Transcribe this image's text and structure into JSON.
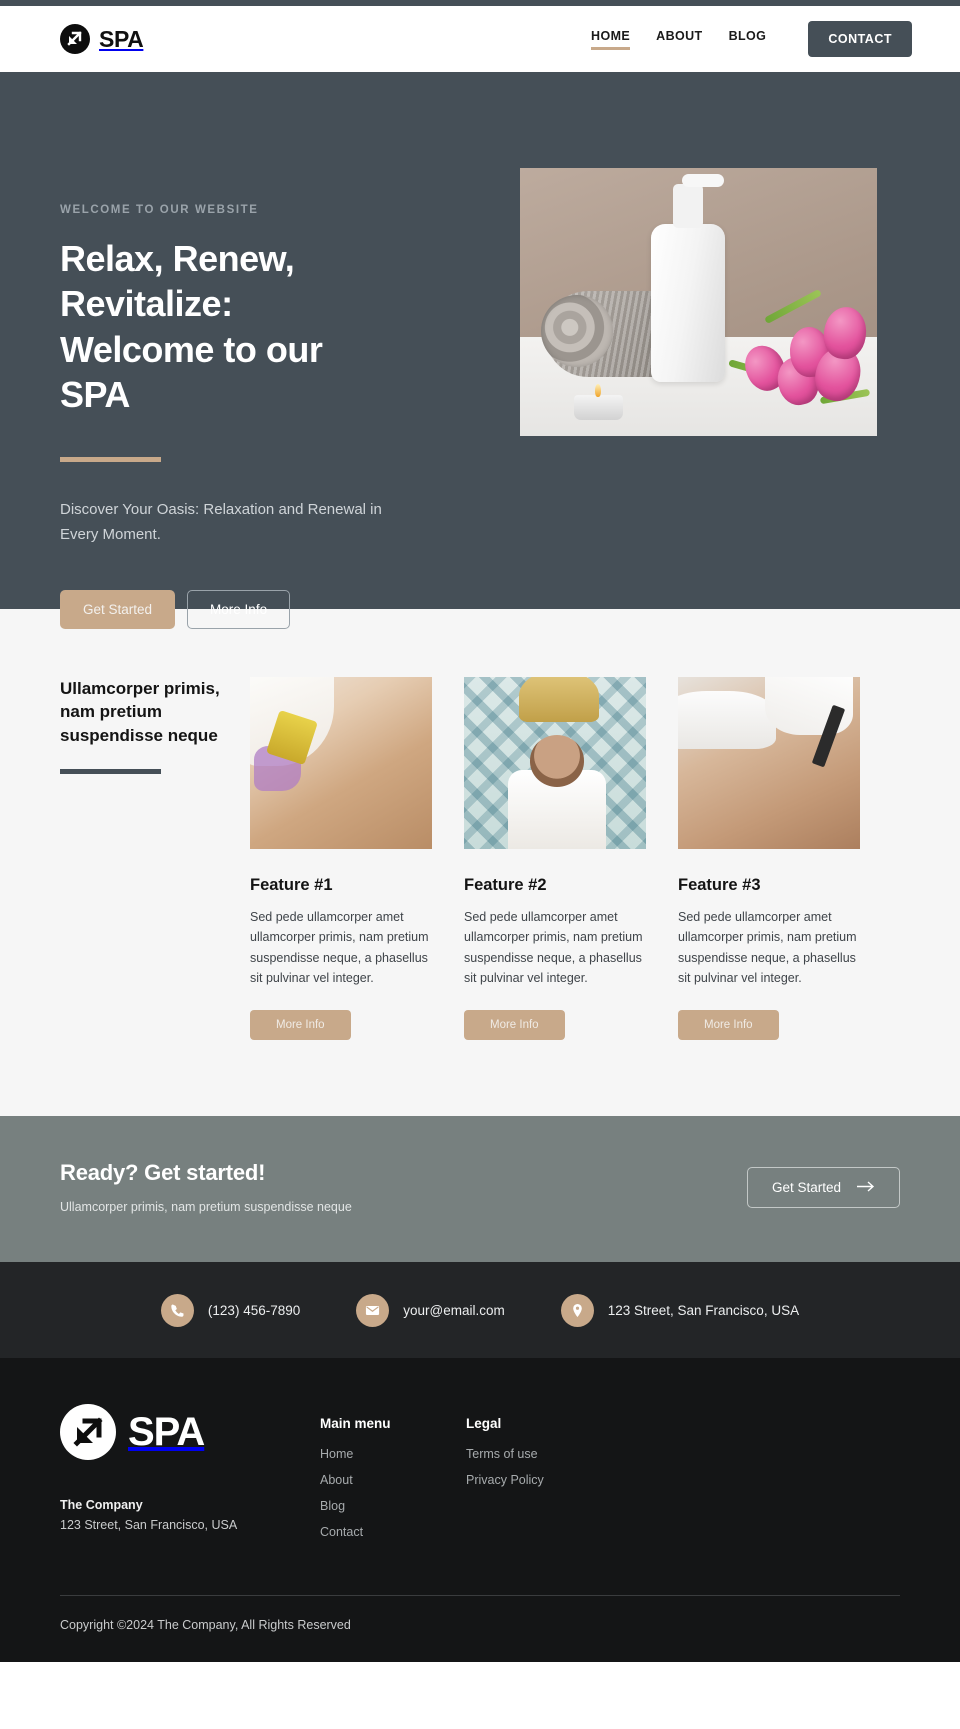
{
  "theme": {
    "accent": "#c8a98a",
    "hero_bg": "#454f57",
    "features_bg": "#f6f6f6",
    "cta_bg": "#77807f",
    "contactbar_bg": "#232527",
    "footer_bg": "#141516"
  },
  "header": {
    "brand": "SPA",
    "logo_icon": "spa-arrow-logo-icon",
    "nav": [
      {
        "label": "HOME",
        "active": true
      },
      {
        "label": "ABOUT",
        "active": false
      },
      {
        "label": "BLOG",
        "active": false
      }
    ],
    "contact_button": "CONTACT"
  },
  "hero": {
    "eyebrow": "WELCOME TO OUR WEBSITE",
    "title": "Relax, Renew, Revitalize: Welcome to our SPA",
    "subtitle": "Discover Your Oasis: Relaxation and Renewal in Every Moment.",
    "primary_button": "Get Started",
    "secondary_button": "More Info",
    "image_alt": "Rolled grey towel, white pump bottle, lit tea-light candle and pink tulips on a white table"
  },
  "features": {
    "heading": "Ullamcorper primis, nam pretium suspendisse neque",
    "cards": [
      {
        "title": "Feature #1",
        "text": "Sed pede ullamcorper amet ullamcorper primis, nam pretium suspendisse neque, a phasellus sit pulvinar vel integer.",
        "button": "More Info",
        "image_alt": "Therapist pouring massage oil onto a client's back"
      },
      {
        "title": "Feature #2",
        "text": "Sed pede ullamcorper amet ullamcorper primis, nam pretium suspendisse neque, a phasellus sit pulvinar vel integer.",
        "button": "More Info",
        "image_alt": "Woman receiving a head massage on a patterned tiled floor"
      },
      {
        "title": "Feature #3",
        "text": "Sed pede ullamcorper amet ullamcorper primis, nam pretium suspendisse neque, a phasellus sit pulvinar vel integer.",
        "button": "More Info",
        "image_alt": "Woman receiving a facial mask treatment with a brush"
      }
    ]
  },
  "cta": {
    "title": "Ready? Get started!",
    "subtitle": "Ullamcorper primis, nam pretium suspendisse neque",
    "button": "Get Started",
    "button_icon": "arrow-right-icon"
  },
  "contactbar": {
    "items": [
      {
        "icon": "phone-icon",
        "text": "(123) 456-7890"
      },
      {
        "icon": "envelope-icon",
        "text": "your@email.com"
      },
      {
        "icon": "map-pin-icon",
        "text": "123 Street, San Francisco, USA"
      }
    ]
  },
  "footer": {
    "brand": "SPA",
    "logo_icon": "spa-arrow-logo-icon",
    "company": "The Company",
    "address": "123 Street, San Francisco, USA",
    "menus": [
      {
        "title": "Main menu",
        "links": [
          "Home",
          "About",
          "Blog",
          "Contact"
        ]
      },
      {
        "title": "Legal",
        "links": [
          "Terms of use",
          "Privacy Policy"
        ]
      }
    ],
    "copyright": "Copyright ©2024 The Company, All Rights Reserved"
  }
}
